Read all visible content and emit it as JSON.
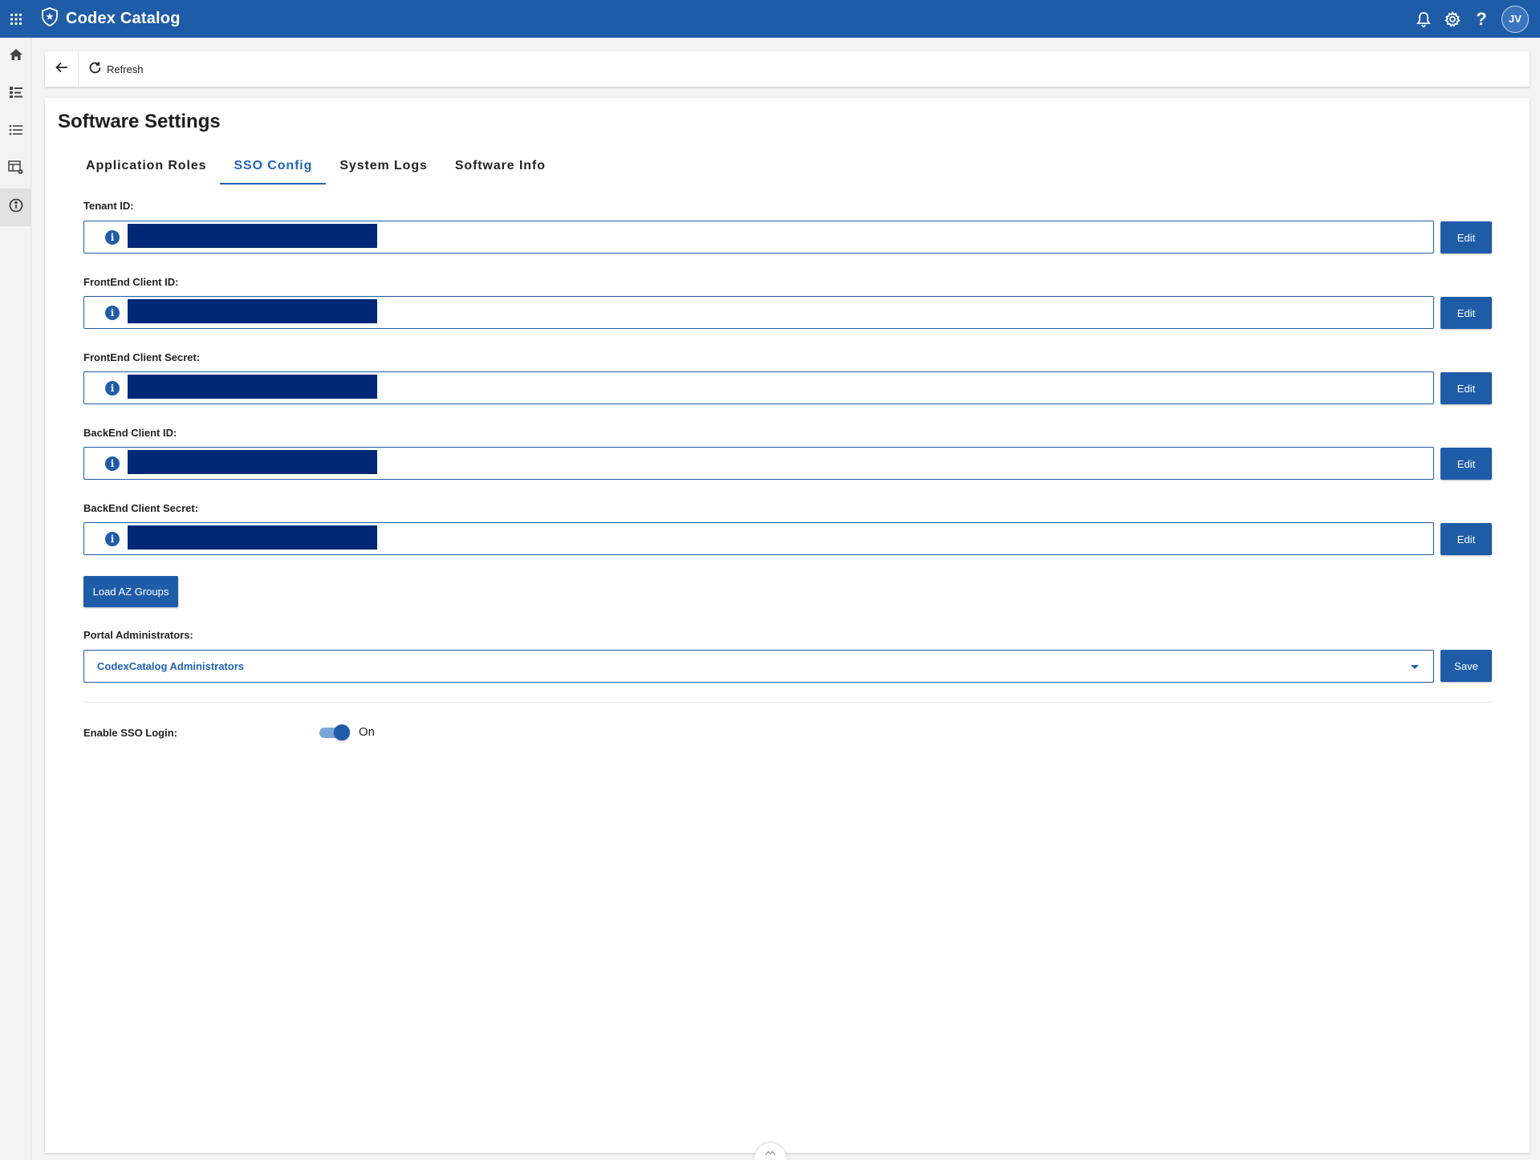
{
  "app": {
    "title": "Codex Catalog",
    "user_initials": "JV",
    "colors": {
      "primary": "#1f5ca8",
      "masked_value": "#002876",
      "active_tab": "#2163b7"
    },
    "icons": [
      "apps-grid-icon",
      "shield-logo-icon",
      "bell-icon",
      "gear-icon",
      "help-icon"
    ]
  },
  "rail": {
    "items": [
      {
        "icon": "home-icon",
        "active": false
      },
      {
        "icon": "list-details-icon",
        "active": false
      },
      {
        "icon": "list-icon",
        "active": false
      },
      {
        "icon": "table-settings-icon",
        "active": false
      },
      {
        "icon": "info-icon",
        "active": true
      }
    ]
  },
  "toolbar": {
    "back_icon": "arrow-left-icon",
    "refresh_label": "Refresh"
  },
  "page": {
    "title": "Software Settings",
    "tabs": [
      {
        "label": "Application Roles",
        "active": false
      },
      {
        "label": "SSO Config",
        "active": true
      },
      {
        "label": "System Logs",
        "active": false
      },
      {
        "label": "Software Info",
        "active": false
      }
    ]
  },
  "fields": [
    {
      "label": "Tenant ID:",
      "button": "Edit",
      "value_masked": true
    },
    {
      "label": "FrontEnd Client ID:",
      "button": "Edit",
      "value_masked": true
    },
    {
      "label": "FrontEnd Client Secret:",
      "button": "Edit",
      "value_masked": true
    },
    {
      "label": "BackEnd Client ID:",
      "button": "Edit",
      "value_masked": true
    },
    {
      "label": "BackEnd Client Secret:",
      "button": "Edit",
      "value_masked": true
    }
  ],
  "load_groups_label": "Load AZ Groups",
  "admins": {
    "label": "Portal Administrators:",
    "selected": "CodexCatalog Administrators",
    "save_label": "Save"
  },
  "sso": {
    "label": "Enable SSO Login:",
    "enabled": true,
    "state_text": "On"
  }
}
